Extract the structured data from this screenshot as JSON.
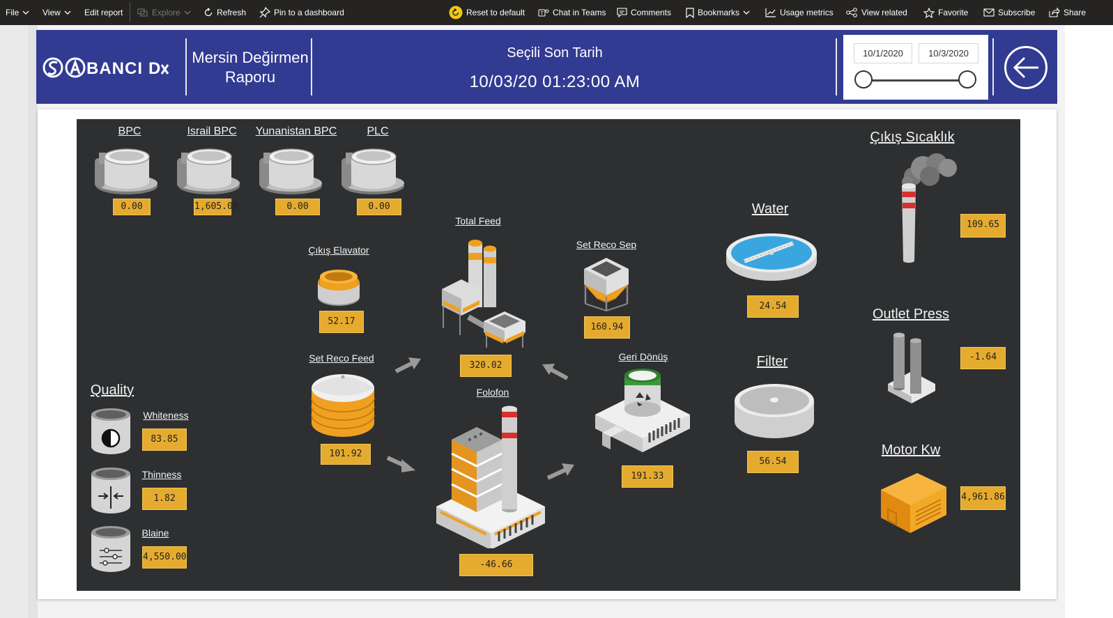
{
  "toolbar": {
    "file": "File",
    "view": "View",
    "edit_report": "Edit report",
    "explore": "Explore",
    "refresh": "Refresh",
    "pin": "Pin to a dashboard",
    "reset": "Reset to default",
    "chat": "Chat in Teams",
    "comments": "Comments",
    "bookmarks": "Bookmarks",
    "usage": "Usage metrics",
    "view_related": "View related",
    "favorite": "Favorite",
    "subscribe": "Subscribe",
    "share": "Share"
  },
  "header": {
    "logo_text": "SABANCI Dx",
    "title_line1": "Mersin Değirmen",
    "title_line2": "Raporu",
    "selected_label": "Seçili Son Tarih",
    "selected_datetime": "10/03/20 01:23:00 AM",
    "date_from": "10/1/2020",
    "date_to": "10/3/2020",
    "back_icon": "arrow-left-circle-icon",
    "accent_color": "#323b92"
  },
  "bpc": {
    "bpc": {
      "label": "BPC",
      "value": "0.00"
    },
    "israil": {
      "label": "Israil BPC",
      "value": "1,605.00"
    },
    "yunanistan": {
      "label": "Yunanistan BPC",
      "value": "0.00"
    },
    "plc": {
      "label": "PLC",
      "value": "0.00"
    }
  },
  "process": {
    "cikis_elavator": {
      "label": "Çıkış Elavator",
      "value": "52.17"
    },
    "total_feed": {
      "label": "Total Feed",
      "value": "320.02"
    },
    "set_reco_sep": {
      "label": "Set Reco Sep",
      "value": "160.94"
    },
    "set_reco_feed": {
      "label": "Set Reco Feed",
      "value": "101.92"
    },
    "geri_donus": {
      "label": "Geri Dönüş",
      "value": "191.33"
    },
    "folofon": {
      "label": "Folofon",
      "value": "-46.66"
    },
    "water": {
      "label": "Water",
      "value": "24.54"
    },
    "filter": {
      "label": "Filter",
      "value": "56.54"
    },
    "cikis_sicaklik": {
      "label": "Çıkış Sıcaklık",
      "value": "109.65"
    },
    "outlet_press": {
      "label": "Outlet Press",
      "value": "-1.64"
    },
    "motor_kw": {
      "label": "Motor Kw",
      "value": "4,961.86"
    }
  },
  "quality": {
    "title": "Quality",
    "whiteness": {
      "label": "Whiteness",
      "value": "83.85"
    },
    "thinness": {
      "label": "Thinness",
      "value": "1.82"
    },
    "blaine": {
      "label": "Blaine",
      "value": "4,550.00"
    }
  },
  "colors": {
    "value_box": "#e5ab2f",
    "stage_bg": "#2d2f31",
    "accent_orange": "#f0a020"
  }
}
